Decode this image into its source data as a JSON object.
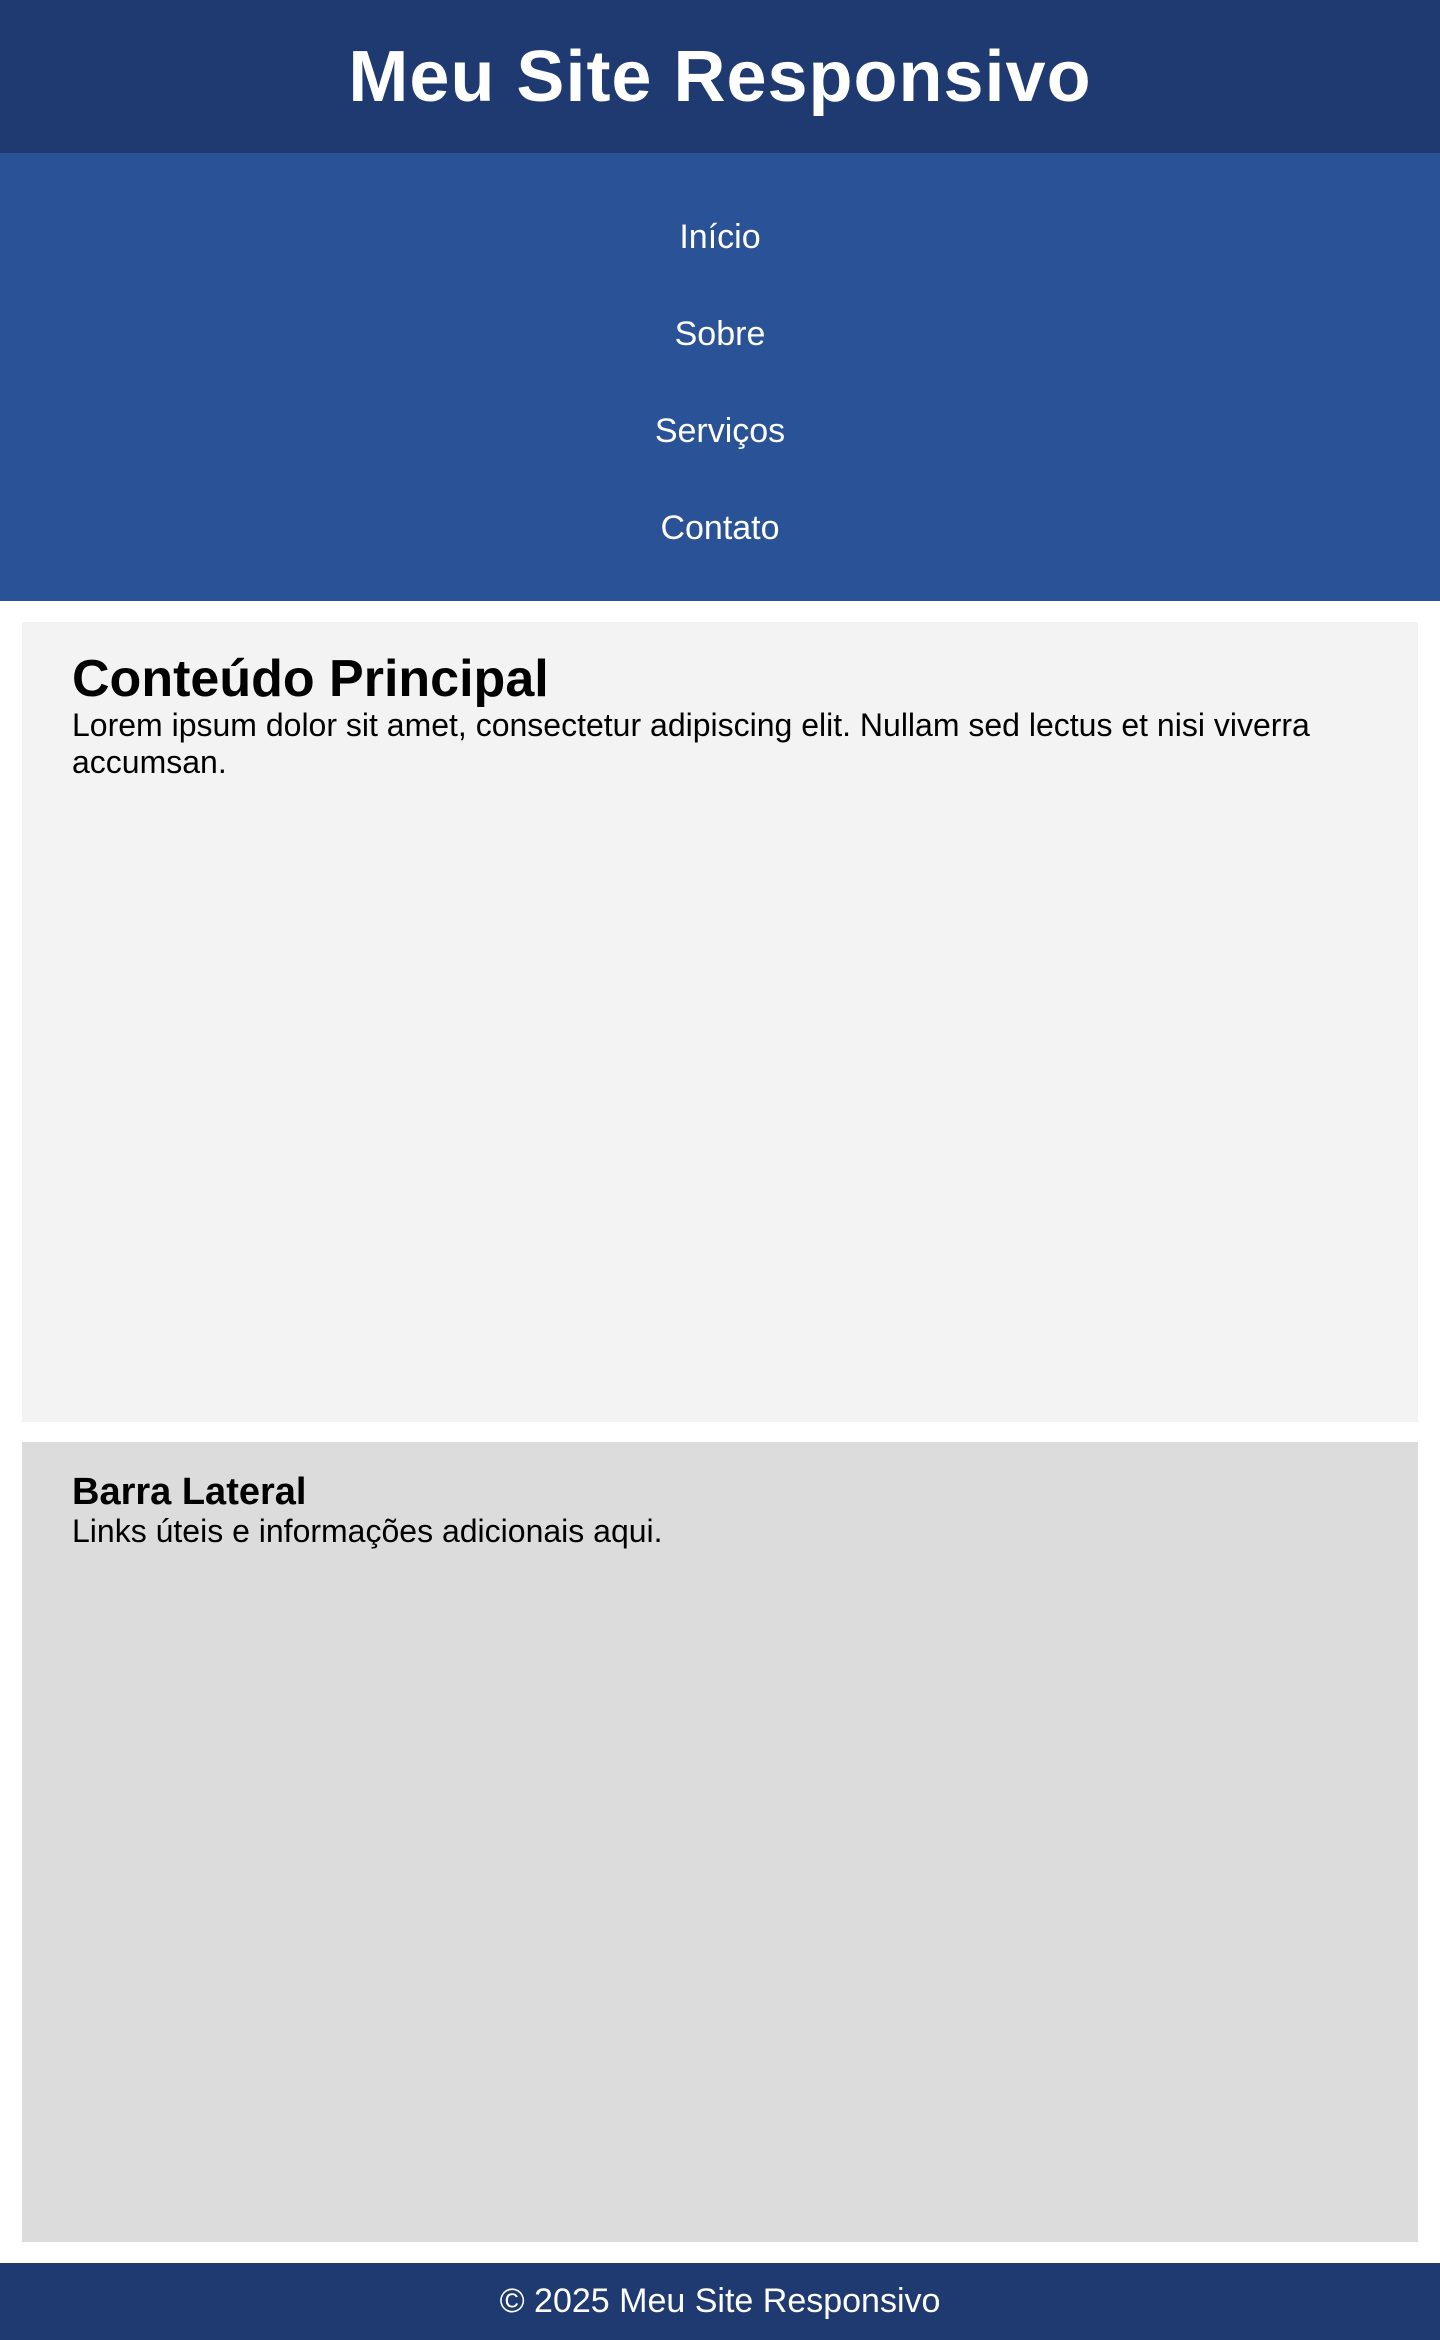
{
  "colors": {
    "header_bg": "#1e3a70",
    "nav_bg": "#2a5296",
    "main_bg": "#f3f3f3",
    "side_bg": "#dcdcdc",
    "footer_bg": "#1e3a70",
    "text_light": "#ffffff",
    "text_dark": "#000000"
  },
  "header": {
    "title": "Meu Site Responsivo"
  },
  "nav": {
    "items": [
      {
        "label": "Início"
      },
      {
        "label": "Sobre"
      },
      {
        "label": "Serviços"
      },
      {
        "label": "Contato"
      }
    ]
  },
  "main": {
    "heading": "Conteúdo Principal",
    "text": "Lorem ipsum dolor sit amet, consectetur adipiscing elit. Nullam sed lectus et nisi viverra accumsan."
  },
  "sidebar": {
    "heading": "Barra Lateral",
    "text": "Links úteis e informações adicionais aqui."
  },
  "footer": {
    "text": "© 2025 Meu Site Responsivo"
  }
}
